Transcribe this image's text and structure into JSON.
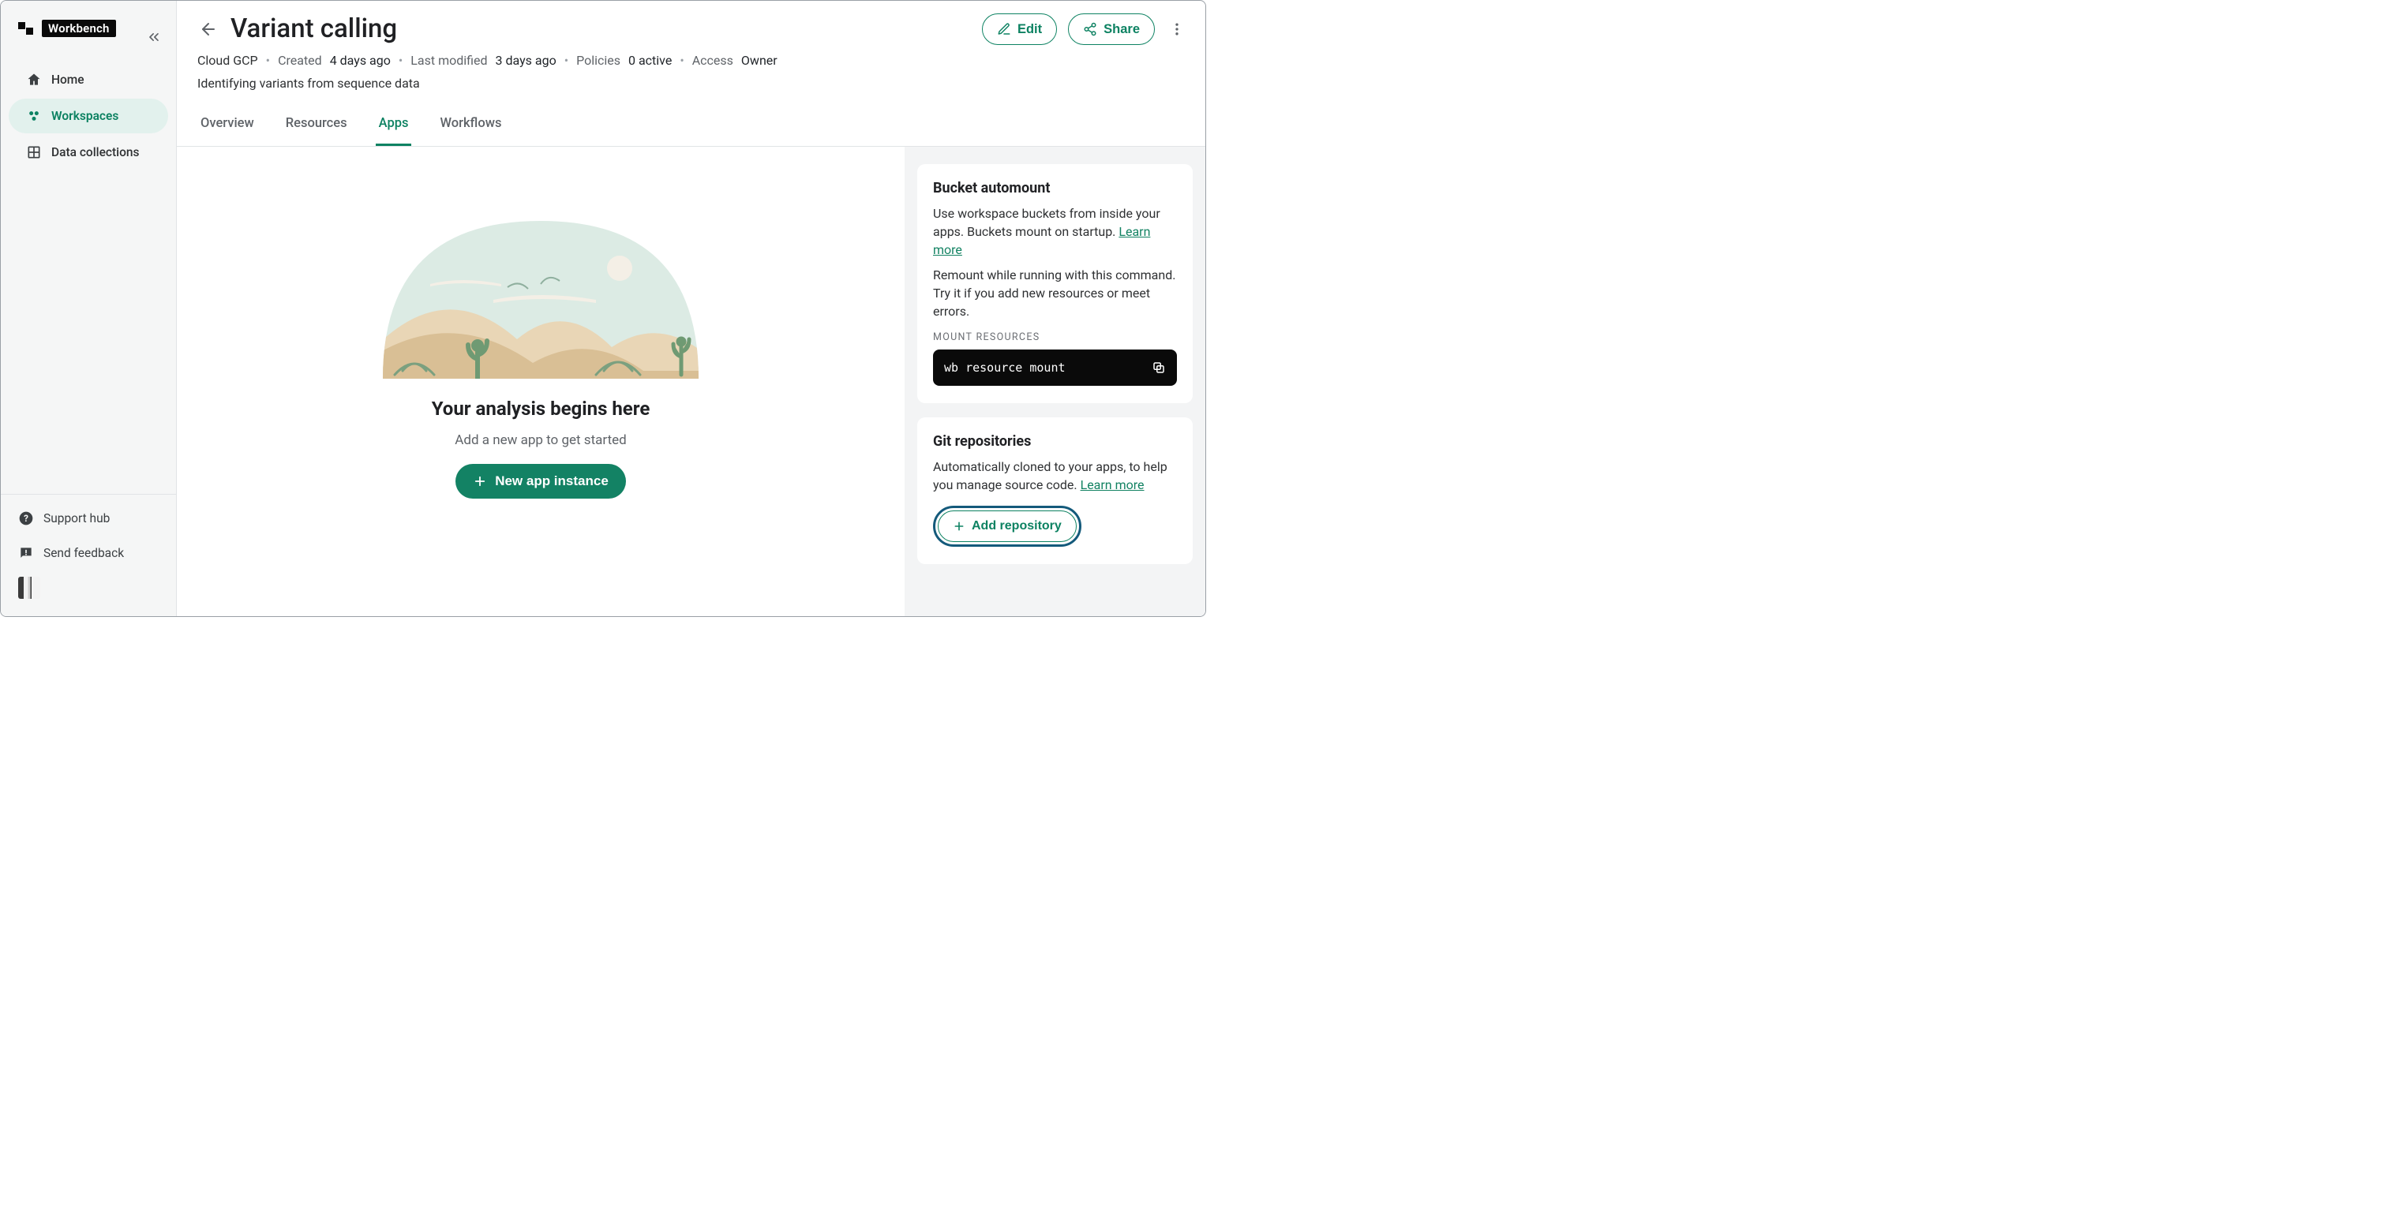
{
  "brand": {
    "tag": "Workbench"
  },
  "sidebar": {
    "items": [
      {
        "label": "Home"
      },
      {
        "label": "Workspaces"
      },
      {
        "label": "Data collections"
      }
    ],
    "footer": [
      {
        "label": "Support hub"
      },
      {
        "label": "Send feedback"
      }
    ]
  },
  "workspace": {
    "title": "Variant calling",
    "cloud": "Cloud GCP",
    "created_label": "Created",
    "created_value": "4 days ago",
    "modified_label": "Last modified",
    "modified_value": "3 days ago",
    "policies_label": "Policies",
    "policies_value": "0 active",
    "access_label": "Access",
    "access_value": "Owner",
    "description": "Identifying variants from sequence data"
  },
  "tabs": [
    {
      "label": "Overview"
    },
    {
      "label": "Resources"
    },
    {
      "label": "Apps",
      "active": true
    },
    {
      "label": "Workflows"
    }
  ],
  "actions": {
    "edit": "Edit",
    "share": "Share"
  },
  "empty_state": {
    "title": "Your analysis begins here",
    "subtitle": "Add a new app to get started",
    "button": "New app instance"
  },
  "side_panel": {
    "bucket": {
      "title": "Bucket automount",
      "line1": "Use workspace buckets from inside your apps. Buckets mount on startup. ",
      "line2": "Remount while running with this command. Try it if you add new resources or meet errors.",
      "learn": "Learn more",
      "cmd_label": "MOUNT RESOURCES",
      "cmd": "wb resource mount"
    },
    "git": {
      "title": "Git repositories",
      "desc": "Automatically cloned to your apps, to help you manage source code. ",
      "learn": "Learn more",
      "add": "Add repository"
    }
  }
}
